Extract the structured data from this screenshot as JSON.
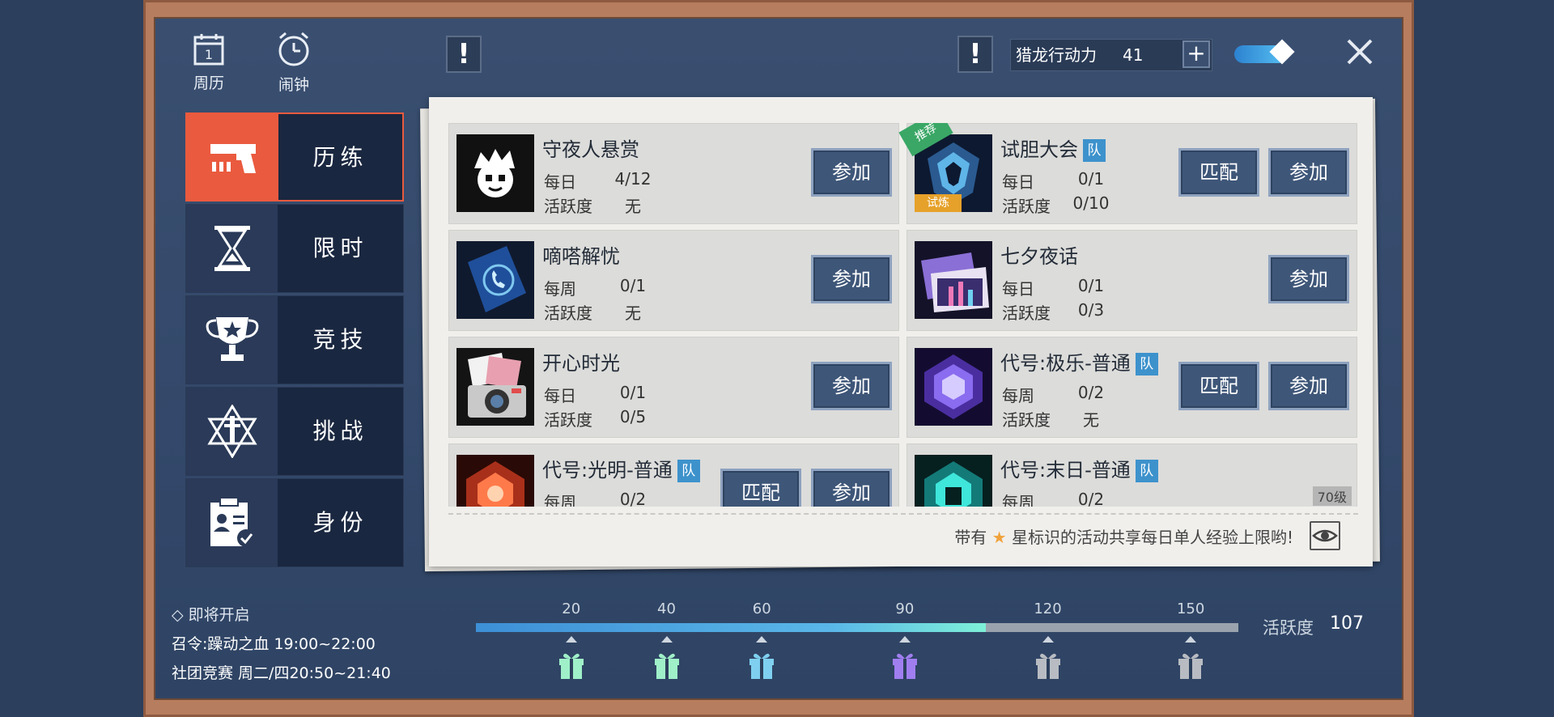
{
  "top_bar": {
    "calendar_label": "周历",
    "alarm_label": "闹钟",
    "stamina_label": "猎龙行动力",
    "stamina_value": "41",
    "plus_label": "+"
  },
  "sidebar": {
    "items": [
      {
        "label": "历练",
        "active": true
      },
      {
        "label": "限时",
        "active": false
      },
      {
        "label": "竞技",
        "active": false
      },
      {
        "label": "挑战",
        "active": false
      },
      {
        "label": "身份",
        "active": false
      }
    ]
  },
  "activities": [
    {
      "name": "守夜人悬赏",
      "team": false,
      "period": "每日",
      "count": "4/12",
      "active_label": "活跃度",
      "active": "无",
      "join": "参加"
    },
    {
      "name": "试胆大会",
      "team": true,
      "team_label": "队",
      "recommended": "推荐",
      "trial": "试炼",
      "period": "每日",
      "count": "0/1",
      "active_label": "活跃度",
      "active": "0/10",
      "match": "匹配",
      "join": "参加"
    },
    {
      "name": "嘀嗒解忧",
      "team": false,
      "period": "每周",
      "count": "0/1",
      "active_label": "活跃度",
      "active": "无",
      "join": "参加"
    },
    {
      "name": "七夕夜话",
      "team": false,
      "period": "每日",
      "count": "0/1",
      "active_label": "活跃度",
      "active": "0/3",
      "join": "参加"
    },
    {
      "name": "开心时光",
      "team": false,
      "period": "每日",
      "count": "0/1",
      "active_label": "活跃度",
      "active": "0/5",
      "join": "参加"
    },
    {
      "name": "代号:极乐-普通",
      "team": true,
      "team_label": "队",
      "period": "每周",
      "count": "0/2",
      "active_label": "活跃度",
      "active": "无",
      "match": "匹配",
      "join": "参加"
    },
    {
      "name": "代号:光明-普通",
      "team": true,
      "team_label": "队",
      "period": "每周",
      "count": "0/2",
      "match": "匹配",
      "join": "参加"
    },
    {
      "name": "代号:末日-普通",
      "team": true,
      "team_label": "队",
      "period": "每周",
      "count": "0/2",
      "level": "70级"
    }
  ],
  "footer_tip": {
    "before": "带有",
    "after": "星标识的活动共享每日单人经验上限哟!"
  },
  "upcoming": {
    "header": "即将开启",
    "events": [
      "召令:躁动之血 19:00~22:00",
      "社团竞赛 周二/四20:50~21:40"
    ]
  },
  "activity_progress": {
    "label": "活跃度",
    "value": "107",
    "current": 107,
    "milestones": [
      "20",
      "40",
      "60",
      "90",
      "120",
      "150"
    ],
    "gift_colors": [
      "#9ff0c8",
      "#9ff0c8",
      "#7fd0f0",
      "#a07ef0",
      "#b8bcc2",
      "#b8bcc2"
    ]
  }
}
